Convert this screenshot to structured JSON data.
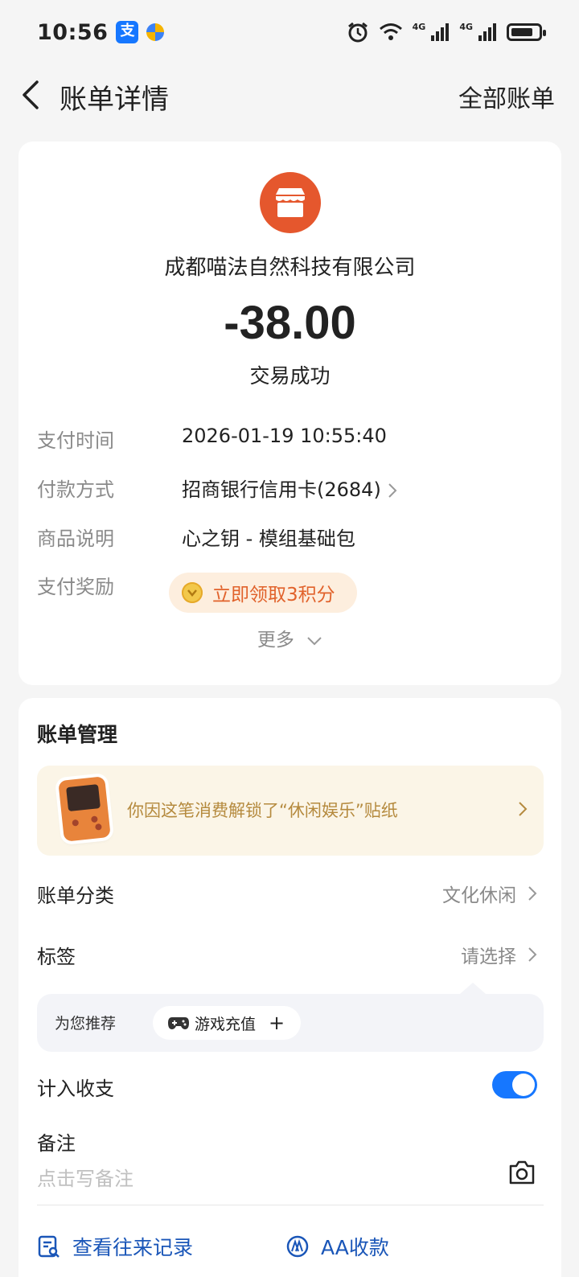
{
  "status_bar": {
    "time": "10:56",
    "alipay_badge": "支",
    "network_1": "4G",
    "network_2": "4G",
    "icons": [
      "alipay-badge-icon",
      "pinwheel-icon",
      "alarm-icon",
      "wifi-icon",
      "signal-icon",
      "signal-icon",
      "battery-icon"
    ]
  },
  "nav": {
    "title": "账单详情",
    "right_link": "全部账单"
  },
  "transaction": {
    "merchant": "成都喵法自然科技有限公司",
    "amount": "-38.00",
    "status": "交易成功",
    "rows": [
      {
        "label": "支付时间",
        "value": "2026-01-19 10:55:40"
      },
      {
        "label": "付款方式",
        "value": "招商银行信用卡(2684)"
      },
      {
        "label": "商品说明",
        "value": "心之钥 - 模组基础包"
      },
      {
        "label": "支付奖励",
        "value": "立即领取3积分"
      }
    ],
    "more": "更多"
  },
  "management": {
    "title": "账单管理",
    "sticker_text": "你因这笔消费解锁了“休闲娱乐”贴纸",
    "category_label": "账单分类",
    "category_value": "文化休闲",
    "tag_label": "标签",
    "tag_value": "请选择",
    "recommend_label": "为您推荐",
    "recommend_tag": "游戏充值",
    "recommend_plus": "+",
    "income_label": "计入收支",
    "income_enabled": true,
    "remark_label": "备注",
    "remark_placeholder": "点击写备注",
    "action_history": "查看往来记录",
    "action_aa": "AA收款"
  },
  "colors": {
    "accent_blue": "#1677ff",
    "merchant_orange": "#e5572d",
    "reward_orange": "#e1622b",
    "link_blue": "#1a56b8"
  }
}
